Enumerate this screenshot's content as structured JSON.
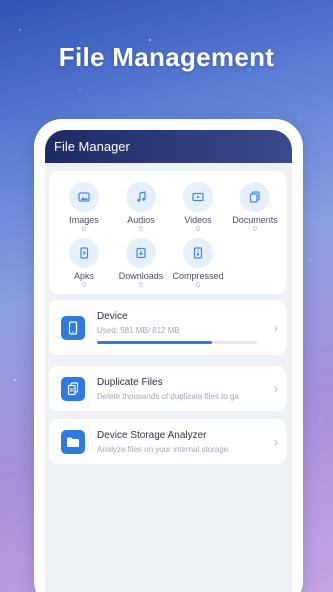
{
  "headline": "File Management",
  "app": {
    "title": "File Manager"
  },
  "categories": [
    {
      "label": "Images",
      "count": "0",
      "icon": "image-icon"
    },
    {
      "label": "Audios",
      "count": "0",
      "icon": "music-note-icon"
    },
    {
      "label": "Videos",
      "count": "0",
      "icon": "video-icon"
    },
    {
      "label": "Documents",
      "count": "0",
      "icon": "document-icon"
    },
    {
      "label": "Apks",
      "count": "0",
      "icon": "apk-icon"
    },
    {
      "label": "Downloads",
      "count": "0",
      "icon": "download-icon"
    },
    {
      "label": "Compressed",
      "count": "0",
      "icon": "archive-icon"
    }
  ],
  "device": {
    "title": "Device",
    "usage": "Used: 581 MB/ 812 MB",
    "used_fraction": 0.72,
    "icon": "phone-icon"
  },
  "duplicate": {
    "title": "Duplicate Files",
    "subtitle": "Delete thousands of duplicate files to ga",
    "icon": "duplicate-files-icon"
  },
  "analyzer": {
    "title": "Device Storage Analyzer",
    "subtitle": "Analyze files on your internal storage",
    "icon": "folder-icon"
  },
  "colors": {
    "accent": "#2d7be0",
    "icon_bg": "#e6f0fb",
    "appbar": "#1e2a64"
  }
}
